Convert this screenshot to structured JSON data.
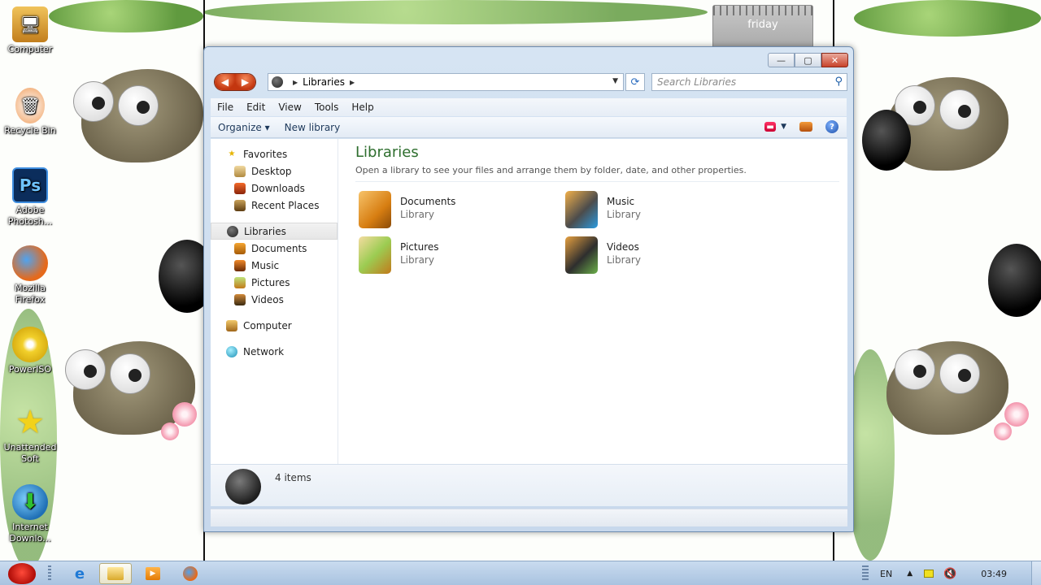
{
  "wallpaper": {
    "calendar_day": "friday"
  },
  "desktop_icons": [
    {
      "label": "Computer",
      "icon": "computer-icon",
      "glyph": "🖥"
    },
    {
      "label": "Recycle Bin",
      "icon": "recycle-bin-icon",
      "glyph": "🗑"
    },
    {
      "label": "Adobe Photosh...",
      "icon": "photoshop-icon",
      "glyph": "Ps"
    },
    {
      "label": "Mozilla Firefox",
      "icon": "firefox-icon",
      "glyph": "🦊"
    },
    {
      "label": "PowerISO",
      "icon": "poweriso-icon",
      "glyph": "💿"
    },
    {
      "label": "Unattended Soft",
      "icon": "star-icon",
      "glyph": "★"
    },
    {
      "label": "Internet Downlo...",
      "icon": "internet-download-icon",
      "glyph": "⬇"
    }
  ],
  "window": {
    "caption": {
      "minimize": "—",
      "maximize": "▢",
      "close": "✕"
    },
    "address": {
      "crumb": "Libraries"
    },
    "search": {
      "placeholder": "Search Libraries"
    },
    "menu": [
      "File",
      "Edit",
      "View",
      "Tools",
      "Help"
    ],
    "toolbar": {
      "organize": "Organize ▾",
      "new_library": "New library"
    },
    "nav": {
      "favorites": "Favorites",
      "favorites_items": [
        "Desktop",
        "Downloads",
        "Recent Places"
      ],
      "libraries": "Libraries",
      "libraries_items": [
        "Documents",
        "Music",
        "Pictures",
        "Videos"
      ],
      "computer": "Computer",
      "network": "Network"
    },
    "content": {
      "title": "Libraries",
      "subtitle": "Open a library to see your files and arrange them by folder, date, and other properties.",
      "libraries": [
        {
          "name": "Documents",
          "type": "Library"
        },
        {
          "name": "Music",
          "type": "Library"
        },
        {
          "name": "Pictures",
          "type": "Library"
        },
        {
          "name": "Videos",
          "type": "Library"
        }
      ]
    },
    "details": {
      "count": "4 items"
    }
  },
  "taskbar": {
    "language": "EN",
    "time": "03:49"
  }
}
